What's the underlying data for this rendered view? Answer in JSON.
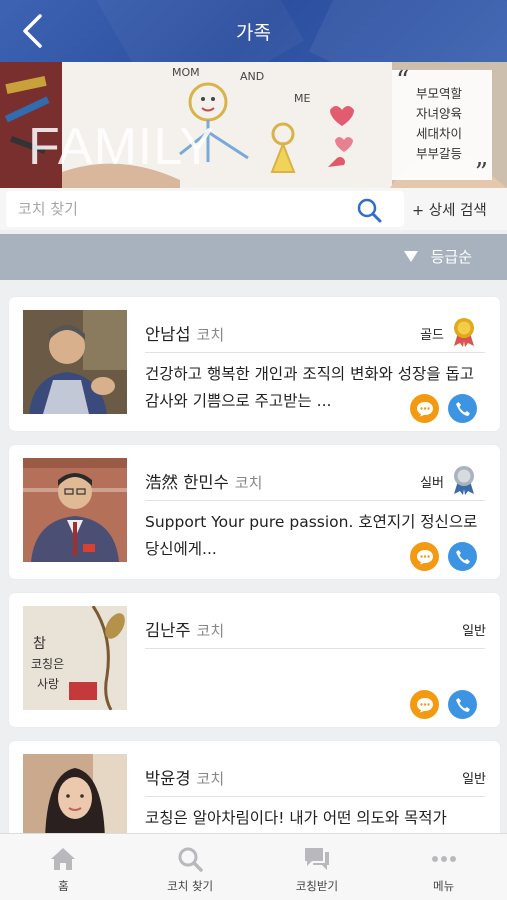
{
  "header": {
    "title": "가족"
  },
  "banner": {
    "word": "FAMILY",
    "drawing_words": [
      "MOM",
      "AND",
      "ME"
    ],
    "tags": [
      "부모역할",
      "자녀양육",
      "세대차이",
      "부부갈등"
    ]
  },
  "search": {
    "placeholder": "코치 찾기",
    "detail_label": "+ 상세 검색"
  },
  "sort": {
    "label": "등급순"
  },
  "coaches": [
    {
      "name": "안남섭",
      "role": "코치",
      "grade": "골드",
      "medal_color": "#e0a81c",
      "intro": "건강하고 행복한 개인과 조직의 변화와 성장을 돕고 감사와 기쁨으로 주고받는 ..."
    },
    {
      "name": "浩然 한민수",
      "role": "코치",
      "grade": "실버",
      "medal_color": "#a9b2bd",
      "intro": "Support Your pure passion. 호연지기 정신으로 당신에게..."
    },
    {
      "name": "김난주",
      "role": "코치",
      "grade": "일반",
      "intro": "",
      "photo_text": [
        "참",
        "코칭은",
        "사랑"
      ]
    },
    {
      "name": "박윤경",
      "role": "코치",
      "grade": "일반",
      "intro": "코칭은 알아차림이다! 내가 어떤 의도와 목적가"
    }
  ],
  "tabs": [
    {
      "label": "홈",
      "icon": "home-icon"
    },
    {
      "label": "코치 찾기",
      "icon": "search-icon"
    },
    {
      "label": "코칭받기",
      "icon": "chat-icon"
    },
    {
      "label": "메뉴",
      "icon": "more-icon"
    }
  ],
  "colors": {
    "header": "#2f54a4",
    "sort_bar": "#a8b2bf",
    "chat": "#f39a12",
    "call": "#3d94e2",
    "gold": "#e0a81c",
    "silver": "#a9b2bd"
  }
}
